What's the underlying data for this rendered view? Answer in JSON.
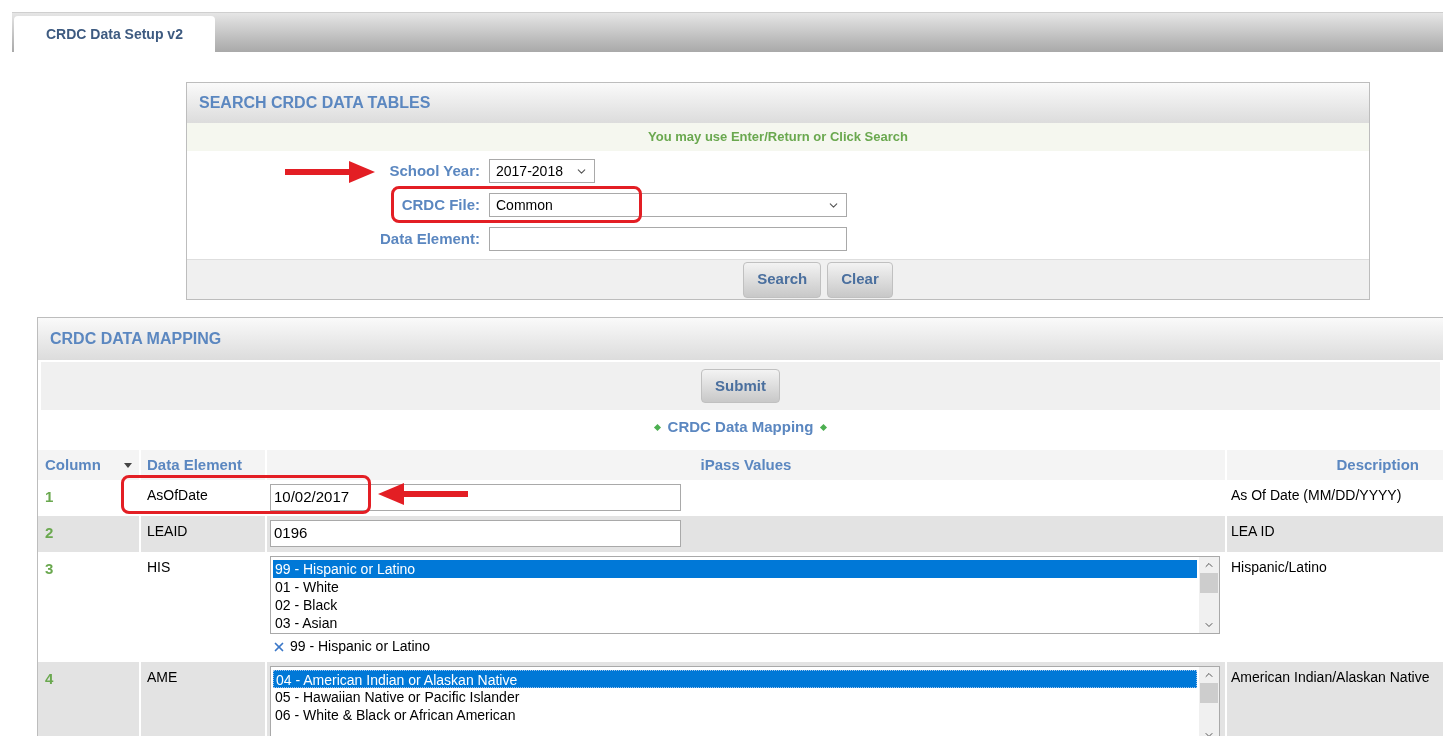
{
  "tabs": [
    {
      "label": "CRDC Data Setup v2",
      "selected": true
    }
  ],
  "search_panel": {
    "title": "SEARCH CRDC DATA TABLES",
    "hint": "You may use Enter/Return or Click Search",
    "fields": [
      {
        "kind": "select",
        "label": "School Year:",
        "value": "2017-2018"
      },
      {
        "kind": "select",
        "label": "CRDC File:",
        "value": "Common"
      },
      {
        "kind": "text",
        "label": "Data Element:"
      }
    ],
    "buttons": [
      "Search",
      "Clear"
    ]
  },
  "mapping_panel": {
    "title": "CRDC DATA MAPPING",
    "submit": "Submit",
    "section_title": "CRDC Data Mapping",
    "columns": [
      "Column",
      "Data Element",
      "iPass Values",
      "Description"
    ],
    "rows": [
      {
        "number": "1",
        "element": "AsOfDate",
        "kind": "text",
        "value": "10/02/2017",
        "description": "As Of Date (MM/DD/YYYY)"
      },
      {
        "number": "2",
        "element": "LEAID",
        "kind": "text",
        "value": "0196",
        "description": "LEA ID"
      },
      {
        "number": "3",
        "element": "HIS",
        "kind": "listbox",
        "options": [
          {
            "label": "99 - Hispanic or Latino",
            "selected": true
          },
          {
            "label": "01 - White",
            "selected": false
          },
          {
            "label": "02 - Black",
            "selected": false
          },
          {
            "label": "03 - Asian",
            "selected": false
          }
        ],
        "chosen": [
          "99 - Hispanic or Latino"
        ],
        "description": "Hispanic/Latino"
      },
      {
        "number": "4",
        "element": "AME",
        "kind": "listbox",
        "options": [
          {
            "label": "04 - American Indian or Alaskan Native",
            "selected": true
          },
          {
            "label": "05 - Hawaiian Native or Pacific Islander",
            "selected": false
          },
          {
            "label": "06 - White & Black or African American",
            "selected": false
          }
        ],
        "description": "American Indian/Alaskan Native"
      }
    ]
  }
}
